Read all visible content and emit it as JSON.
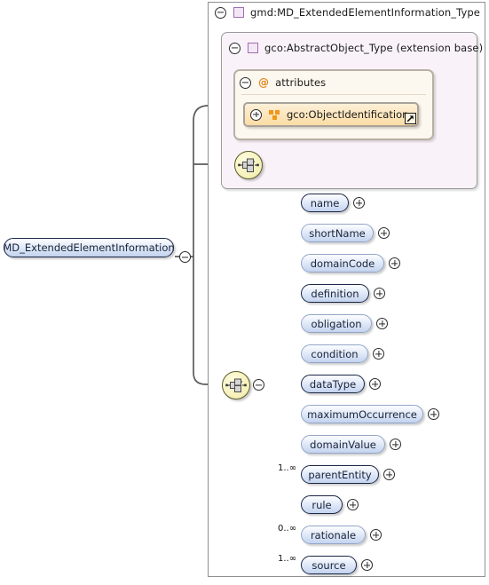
{
  "diagram": {
    "kind": "xml-schema-element-diagram",
    "root_element": {
      "label": "MD_ExtendedElementInformation",
      "toggle": "minus"
    },
    "type_box": {
      "label": "gmd:MD_ExtendedElementInformation_Type",
      "toggle": "minus",
      "icon": "complex-type-square-icon"
    },
    "extension_box": {
      "label": "gco:AbstractObject_Type (extension base)",
      "toggle": "minus",
      "icon": "complex-type-square-icon"
    },
    "attributes_box": {
      "label": "attributes",
      "toggle": "minus",
      "icon": "at-sign-icon",
      "items": [
        {
          "label": "gco:ObjectIdentification",
          "toggle": "plus",
          "icon": "attribute-group-icon",
          "external_link": true
        }
      ]
    },
    "compositors": [
      {
        "name": "sequence-extension",
        "type": "sequence"
      },
      {
        "name": "sequence-elements",
        "type": "sequence",
        "toggle": "minus"
      }
    ],
    "elements": [
      {
        "label": "name",
        "required": true,
        "toggle": "plus",
        "cardinality": ""
      },
      {
        "label": "shortName",
        "required": false,
        "toggle": "plus",
        "cardinality": ""
      },
      {
        "label": "domainCode",
        "required": false,
        "toggle": "plus",
        "cardinality": ""
      },
      {
        "label": "definition",
        "required": true,
        "toggle": "plus",
        "cardinality": ""
      },
      {
        "label": "obligation",
        "required": false,
        "toggle": "plus",
        "cardinality": ""
      },
      {
        "label": "condition",
        "required": false,
        "toggle": "plus",
        "cardinality": ""
      },
      {
        "label": "dataType",
        "required": true,
        "toggle": "plus",
        "cardinality": ""
      },
      {
        "label": "maximumOccurrence",
        "required": false,
        "toggle": "plus",
        "cardinality": ""
      },
      {
        "label": "domainValue",
        "required": false,
        "toggle": "plus",
        "cardinality": ""
      },
      {
        "label": "parentEntity",
        "required": true,
        "toggle": "plus",
        "cardinality": "1..∞"
      },
      {
        "label": "rule",
        "required": true,
        "toggle": "plus",
        "cardinality": ""
      },
      {
        "label": "rationale",
        "required": false,
        "toggle": "plus",
        "cardinality": "0..∞"
      },
      {
        "label": "source",
        "required": true,
        "toggle": "plus",
        "cardinality": "1..∞"
      }
    ],
    "colors": {
      "type_frame_border": "#8f8f8f",
      "extension_bg": "#f9f2f9",
      "attributes_bg": "#fdf8ef",
      "attribute_pill": "#fbdca4",
      "element_pill": "#c3d3ef",
      "element_border_required": "#1b2746",
      "compositor_fill": "#f6f0b8",
      "accent_orange": "#f0971b",
      "accent_purple": "#9c6fb0"
    }
  }
}
